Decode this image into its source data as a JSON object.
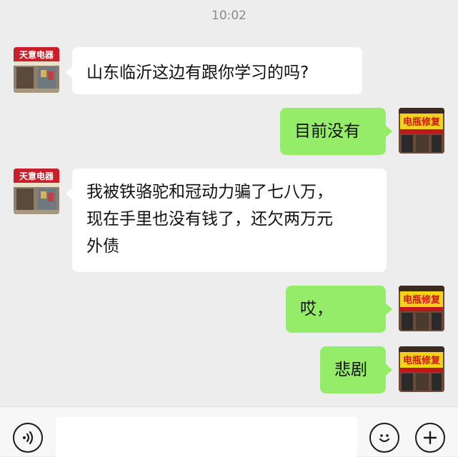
{
  "timestamp": "10:02",
  "messages": [
    {
      "side": "in",
      "text": "山东临沂这边有跟你学习的吗?"
    },
    {
      "side": "out",
      "text": "目前没有"
    },
    {
      "side": "in",
      "lines": [
        "我被铁骆驼和冠动力骗了七八万，",
        "现在手里也没有钱了，还欠两万元",
        "外债"
      ]
    },
    {
      "side": "out",
      "text": "哎，"
    },
    {
      "side": "out",
      "text": "悲剧"
    }
  ],
  "contact_avatar": {
    "sign_text": "天意电器",
    "icon": "storefront-photo"
  },
  "my_avatar": {
    "sign_text": "电瓶修复",
    "icon": "storefront-photo"
  },
  "colors": {
    "background": "#ededed",
    "incoming_bubble": "#ffffff",
    "outgoing_bubble": "#95ec69"
  },
  "input_bar": {
    "voice_icon": "voice-icon",
    "emoji_icon": "emoji-icon",
    "more_icon": "plus-icon",
    "value": ""
  }
}
